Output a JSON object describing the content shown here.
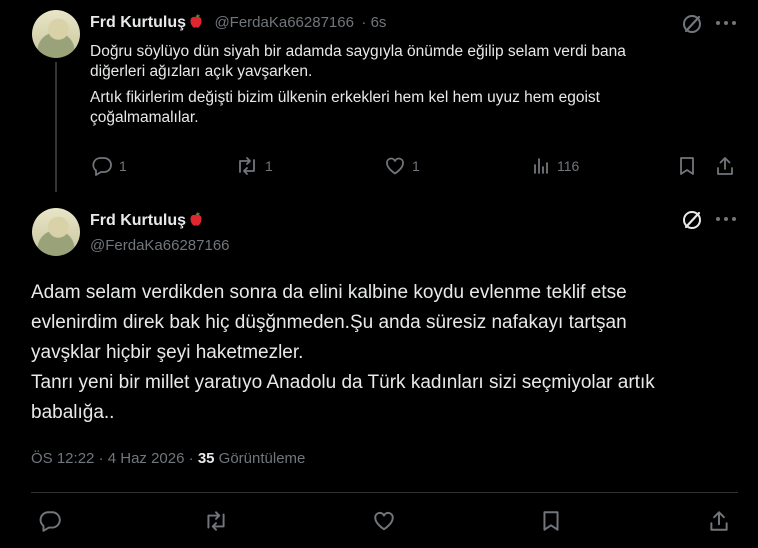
{
  "tweet1": {
    "name": "Frd Kurtuluş",
    "handle": "@FerdaKa66287166",
    "time": "· 6s",
    "lines": [
      "Doğru söylüyo dün siyah bir adamda saygıyla önümde eğilip selam verdi bana",
      "diğerleri ağızları açık yavşarken.",
      "Artık fikirlerim değişti bizim ülkenin erkekleri hem kel hem uyuz hem egoist",
      "çoğalmamalılar."
    ],
    "replies": "1",
    "reposts": "1",
    "likes": "1",
    "views": "116"
  },
  "tweet2": {
    "name": "Frd Kurtuluş",
    "handle": "@FerdaKa66287166",
    "lines": [
      "Adam selam verdikden sonra da elini kalbine koydu evlenme teklif etse",
      "evlenirdim direk bak hiç düşğnmeden.Şu anda süresiz nafakayı tartşan",
      "yavşklar hiçbir şeyi haketmezler.",
      "Tanrı yeni bir millet yaratıyo Anadolu da Türk kadınları sizi seçmiyolar artık",
      "babalığa.."
    ],
    "time": "ÖS 12:22",
    "date": "4 Haz 2026",
    "separator": "·",
    "views_count": "35",
    "views_label": "Görüntüleme"
  },
  "icons": {
    "apple": "red-apple-emoji",
    "grok": "grok-icon",
    "more": "more-icon"
  },
  "colors": {
    "background": "#000000",
    "text": "#e7e9ea",
    "muted": "#71767b",
    "divider": "#2f3336",
    "apple": "#e0262e"
  }
}
